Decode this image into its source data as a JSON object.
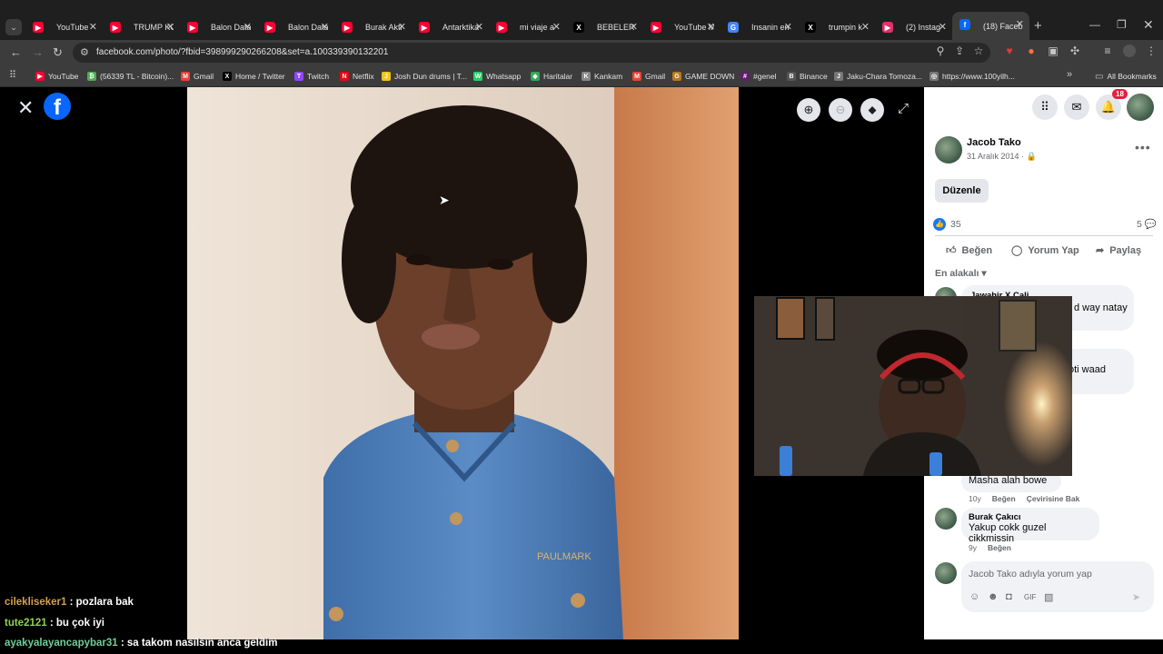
{
  "tabs": [
    {
      "title": "YouTube",
      "icon": "youtube-icon",
      "color": "#ff0033"
    },
    {
      "title": "TRUMP KO",
      "icon": "youtube-icon",
      "color": "#ff0033"
    },
    {
      "title": "Balon Data",
      "icon": "youtube-icon",
      "color": "#ff0033"
    },
    {
      "title": "Balon Data",
      "icon": "youtube-icon",
      "color": "#ff0033"
    },
    {
      "title": "Burak Akti",
      "icon": "youtube-icon",
      "color": "#ff0033"
    },
    {
      "title": "Antarktika",
      "icon": "youtube-icon",
      "color": "#ff0033"
    },
    {
      "title": "mi viaje a",
      "icon": "youtube-icon",
      "color": "#ff0033"
    },
    {
      "title": "BEBELER T",
      "icon": "x-icon",
      "color": "#000000"
    },
    {
      "title": "YouTube M",
      "icon": "youtube-music-icon",
      "color": "#ff0033"
    },
    {
      "title": "Insanin en",
      "icon": "google-icon",
      "color": "#4285f4"
    },
    {
      "title": "trumpin k",
      "icon": "x-icon",
      "color": "#000000"
    },
    {
      "title": "(2) Instag",
      "icon": "instagram-icon",
      "color": "#e1306c"
    },
    {
      "title": "(18) Faceb",
      "icon": "facebook-icon",
      "color": "#0866ff"
    }
  ],
  "address": {
    "url": "facebook.com/photo/?fbid=398999290266208&set=a.100339390132201"
  },
  "bookmarks": [
    {
      "label": "YouTube",
      "color": "#ff0033",
      "glyph": "▶"
    },
    {
      "label": "(56339 TL - Bitcoin)...",
      "color": "#4caf50",
      "glyph": "₿"
    },
    {
      "label": "Gmail",
      "color": "#ea4335",
      "glyph": "M"
    },
    {
      "label": "Home / Twitter",
      "color": "#000000",
      "glyph": "X"
    },
    {
      "label": "Twitch",
      "color": "#9146ff",
      "glyph": "T"
    },
    {
      "label": "Netflix",
      "color": "#e50914",
      "glyph": "N"
    },
    {
      "label": "Josh Dun drums | T...",
      "color": "#f5c518",
      "glyph": "J"
    },
    {
      "label": "Whatsapp",
      "color": "#25d366",
      "glyph": "W"
    },
    {
      "label": "Haritalar",
      "color": "#34a853",
      "glyph": "◆"
    },
    {
      "label": "Kankam",
      "color": "#888888",
      "glyph": "K"
    },
    {
      "label": "Gmail",
      "color": "#ea4335",
      "glyph": "M"
    },
    {
      "label": "GAME DOWN",
      "color": "#b7791f",
      "glyph": "G"
    },
    {
      "label": "#genel",
      "color": "#611f69",
      "glyph": "#"
    },
    {
      "label": "Binance",
      "color": "#555555",
      "glyph": "B"
    },
    {
      "label": "Jaku-Chara Tomoza...",
      "color": "#777777",
      "glyph": "J"
    },
    {
      "label": "https://www.100yilh...",
      "color": "#777777",
      "glyph": "◎"
    }
  ],
  "all_bookmarks": "All Bookmarks",
  "post": {
    "author": "Jacob Tako",
    "date": "31 Aralık 2014 ·",
    "edit_label": "Düzenle",
    "like_count": "35",
    "comment_count": "5",
    "actions": {
      "like": "Beğen",
      "comment": "Yorum Yap",
      "share": "Paylaş"
    },
    "sort_label": "En alakalı"
  },
  "notifications_badge": "18",
  "comments": [
    {
      "name": "Jawahir X Cali",
      "text": "d way natay"
    },
    {
      "name": "",
      "text": "oti waad"
    },
    {
      "name": "",
      "text": "Masha alah bowe",
      "age": "10y",
      "like": "Beğen",
      "translate": "Çevirisine Bak"
    },
    {
      "name": "Burak Çakıcı",
      "text": "Yakup cokk guzel cikkmissin",
      "age": "9y",
      "like": "Beğen"
    }
  ],
  "composer_placeholder": "Jacob Tako adıyla yorum yap",
  "chat": [
    {
      "user": "cilekliseker1",
      "message": ": pozlara bak"
    },
    {
      "user": "tute2121",
      "message": ": bu çok iyi"
    },
    {
      "user": "ayakyalayancapybar31",
      "message": ": sa takom nasılsın anca geldim"
    }
  ],
  "photo": {
    "shirt_text": "PAULMARK"
  },
  "colors": {
    "fb_blue": "#0866ff",
    "panel_bg": "#ffffff",
    "viewer_bg": "#000000"
  }
}
